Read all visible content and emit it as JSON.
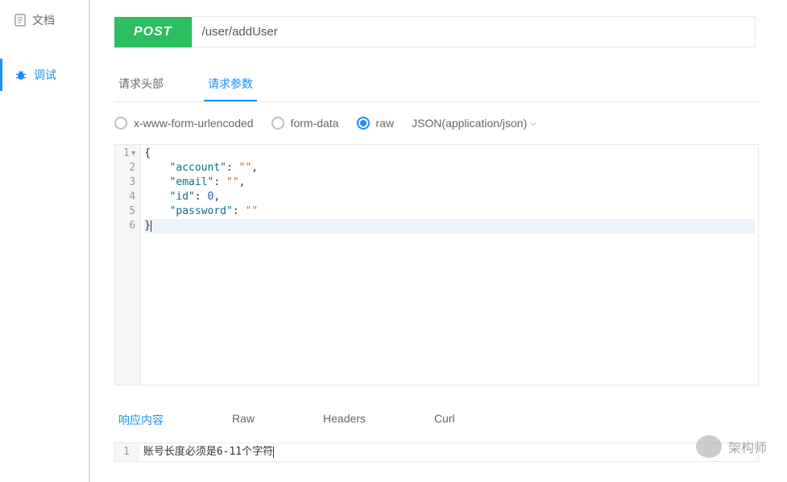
{
  "sidebar": {
    "items": [
      {
        "label": "文档",
        "icon": "document-icon"
      },
      {
        "label": "调试",
        "icon": "bug-icon"
      }
    ]
  },
  "request": {
    "method": "POST",
    "url": "/user/addUser"
  },
  "tabs": {
    "headers": "请求头部",
    "params": "请求参数"
  },
  "bodyType": {
    "urlencoded": "x-www-form-urlencoded",
    "formdata": "form-data",
    "raw": "raw",
    "contentType": "JSON(application/json)"
  },
  "editor": {
    "lines": {
      "l1": "{",
      "l2_key": "\"account\"",
      "l2_rest": ": ",
      "l2_val": "\"\"",
      "l2_end": ",",
      "l3_key": "\"email\"",
      "l3_rest": ": ",
      "l3_val": "\"\"",
      "l3_end": ",",
      "l4_key": "\"id\"",
      "l4_rest": ": ",
      "l4_val": "0",
      "l4_end": ",",
      "l5_key": "\"password\"",
      "l5_rest": ": ",
      "l5_val": "\"\"",
      "l6": "}"
    }
  },
  "responseTabs": {
    "content": "响应内容",
    "raw": "Raw",
    "headers": "Headers",
    "curl": "Curl"
  },
  "response": {
    "line1": "账号长度必须是6-11个字符"
  },
  "watermark": {
    "text": "架构师"
  }
}
